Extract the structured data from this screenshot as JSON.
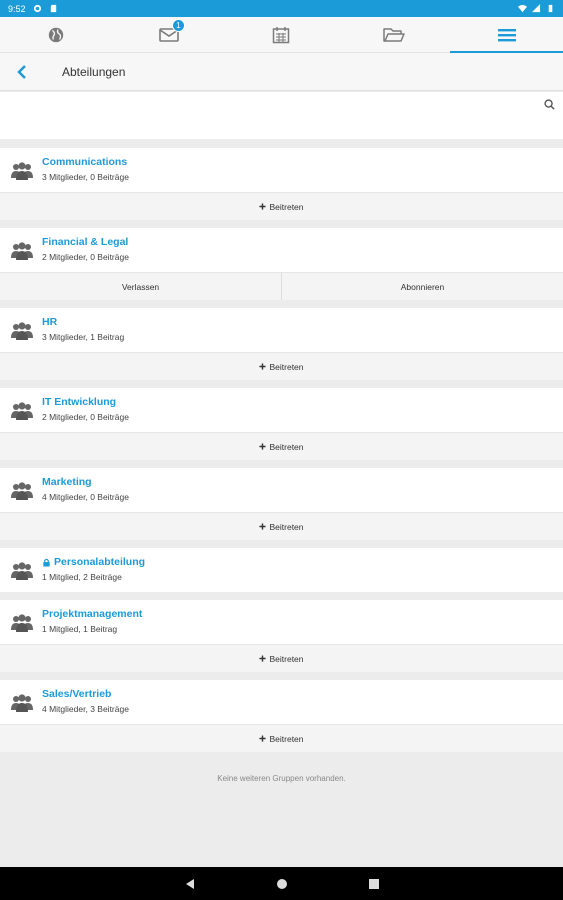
{
  "status_bar": {
    "time": "9:52"
  },
  "tabs": [
    {
      "icon": "globe-icon",
      "active": false
    },
    {
      "icon": "mail-icon",
      "badge": "1",
      "active": false
    },
    {
      "icon": "calendar-icon",
      "active": false
    },
    {
      "icon": "folder-icon",
      "active": false
    },
    {
      "icon": "menu-icon",
      "active": true
    }
  ],
  "header": {
    "title": "Abteilungen"
  },
  "search": {
    "placeholder": "",
    "value": ""
  },
  "groups": [
    {
      "name": "Communications",
      "meta": "3 Mitglieder, 0 Beiträge",
      "locked": false,
      "actions": [
        "Beitreten"
      ]
    },
    {
      "name": "Financial & Legal",
      "meta": "2 Mitglieder, 0 Beiträge",
      "locked": false,
      "actions": [
        "Verlassen",
        "Abonnieren"
      ]
    },
    {
      "name": "HR",
      "meta": "3 Mitglieder, 1 Beitrag",
      "locked": false,
      "actions": [
        "Beitreten"
      ]
    },
    {
      "name": "IT Entwicklung",
      "meta": "2 Mitglieder, 0 Beiträge",
      "locked": false,
      "actions": [
        "Beitreten"
      ]
    },
    {
      "name": "Marketing",
      "meta": "4 Mitglieder, 0 Beiträge",
      "locked": false,
      "actions": [
        "Beitreten"
      ]
    },
    {
      "name": "Personalabteilung",
      "meta": "1 Mitglied, 2 Beiträge",
      "locked": true,
      "actions": []
    },
    {
      "name": "Projektmanagement",
      "meta": "1 Mitglied, 1 Beitrag",
      "locked": false,
      "actions": [
        "Beitreten"
      ]
    },
    {
      "name": "Sales/Vertrieb",
      "meta": "4 Mitglieder, 3 Beiträge",
      "locked": false,
      "actions": [
        "Beitreten"
      ]
    }
  ],
  "footer": {
    "text": "Keine weiteren Gruppen vorhanden."
  },
  "colors": {
    "accent": "#1b9bd8",
    "background": "#ececec",
    "action_bg": "#f4f4f4"
  }
}
